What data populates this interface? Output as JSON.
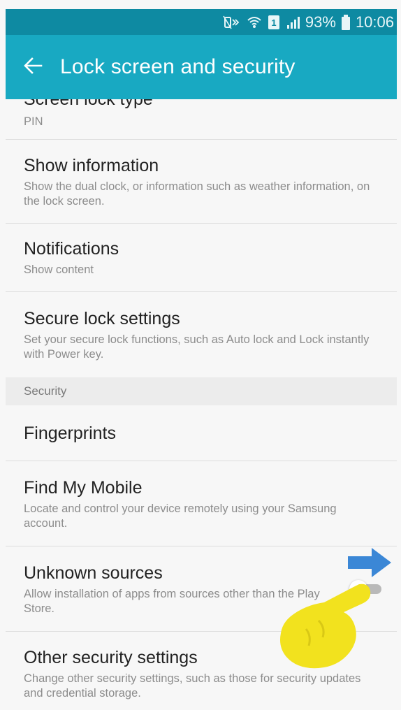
{
  "status_bar": {
    "battery_percent": "93%",
    "time": "10:06",
    "icons": [
      "mute-vibrate-icon",
      "wifi-icon",
      "sim-1-icon",
      "signal-icon",
      "battery-icon"
    ]
  },
  "app_bar": {
    "back_icon": "back-arrow-icon",
    "title": "Lock screen and security"
  },
  "list": {
    "screen_lock_type": {
      "title": "Screen lock type",
      "subtitle": "PIN"
    },
    "show_information": {
      "title": "Show information",
      "subtitle": "Show the dual clock, or information such as weather information, on the lock screen."
    },
    "notifications": {
      "title": "Notifications",
      "subtitle": "Show content"
    },
    "secure_lock_settings": {
      "title": "Secure lock settings",
      "subtitle": "Set your secure lock functions, such as Auto lock and Lock instantly with Power key."
    },
    "security_header": "Security",
    "fingerprints": {
      "title": "Fingerprints"
    },
    "find_my_mobile": {
      "title": "Find My Mobile",
      "subtitle": "Locate and control your device remotely using your Samsung account."
    },
    "unknown_sources": {
      "title": "Unknown sources",
      "subtitle": "Allow installation of apps from sources other than the Play Store.",
      "toggle_on": false
    },
    "other_security_settings": {
      "title": "Other security settings",
      "subtitle": "Change other security settings, such as those for security updates and credential storage."
    }
  },
  "overlay": {
    "arrow_icon": "blue-arrow-right-icon",
    "hand_icon": "pointing-hand-icon"
  },
  "colors": {
    "status_bar": "#0e8aa2",
    "app_bar": "#18a9c2",
    "background": "#f7f7f7",
    "arrow": "#3b87d6",
    "hand": "#f2e21e"
  }
}
